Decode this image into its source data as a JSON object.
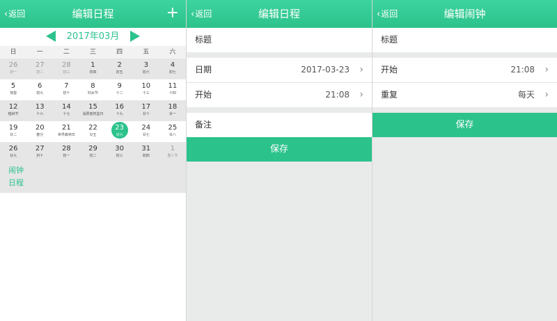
{
  "calendar_screen": {
    "back_label": "返回",
    "title": "编辑日程",
    "add_label": "+",
    "month_label": "2017年03月",
    "weekdays": [
      "日",
      "一",
      "二",
      "三",
      "四",
      "五",
      "六"
    ],
    "weeks": [
      [
        [
          "26",
          "初一"
        ],
        [
          "27",
          "初二"
        ],
        [
          "28",
          "初三"
        ],
        [
          "1",
          "初四"
        ],
        [
          "2",
          "初五"
        ],
        [
          "3",
          "初六"
        ],
        [
          "4",
          "初七"
        ]
      ],
      [
        [
          "5",
          "惊蛰"
        ],
        [
          "6",
          "初九"
        ],
        [
          "7",
          "初十"
        ],
        [
          "8",
          "妇女节"
        ],
        [
          "9",
          "十二"
        ],
        [
          "10",
          "十三"
        ],
        [
          "11",
          "十四"
        ]
      ],
      [
        [
          "12",
          "植树节"
        ],
        [
          "13",
          "十六"
        ],
        [
          "14",
          "十七"
        ],
        [
          "15",
          "消费者权益日"
        ],
        [
          "16",
          "十九"
        ],
        [
          "17",
          "廿十"
        ],
        [
          "18",
          "廿一"
        ]
      ],
      [
        [
          "19",
          "廿二"
        ],
        [
          "20",
          "春分"
        ],
        [
          "21",
          "世界森林日"
        ],
        [
          "22",
          "廿五"
        ],
        [
          "23",
          "廿六"
        ],
        [
          "24",
          "廿七"
        ],
        [
          "25",
          "廿八"
        ]
      ],
      [
        [
          "26",
          "廿九"
        ],
        [
          "27",
          "卅十"
        ],
        [
          "28",
          "初一"
        ],
        [
          "29",
          "初二"
        ],
        [
          "30",
          "初三"
        ],
        [
          "31",
          "初四"
        ],
        [
          "1",
          "愚人节"
        ]
      ]
    ],
    "other_month_cells": [
      "0-0",
      "0-1",
      "0-2",
      "4-6"
    ],
    "today_cell": "3-4",
    "link_alarm": "闹钟",
    "link_schedule": "日程"
  },
  "edit_schedule_screen": {
    "back_label": "返回",
    "title": "编辑日程",
    "title_field_label": "标题",
    "date_label": "日期",
    "date_value": "2017-03-23",
    "start_label": "开始",
    "start_value": "21:08",
    "note_label": "备注",
    "save_label": "保存"
  },
  "edit_alarm_screen": {
    "back_label": "返回",
    "title": "编辑闹钟",
    "title_field_label": "标题",
    "start_label": "开始",
    "start_value": "21:08",
    "repeat_label": "重复",
    "repeat_value": "每天",
    "save_label": "保存"
  },
  "icons": {
    "back": "chevron-left-icon",
    "row_arrow": "chevron-right-icon",
    "month_prev": "triangle-left-icon",
    "month_next": "triangle-right-icon"
  },
  "colors": {
    "accent": "#2cc28c",
    "background": "#e9eaea"
  }
}
